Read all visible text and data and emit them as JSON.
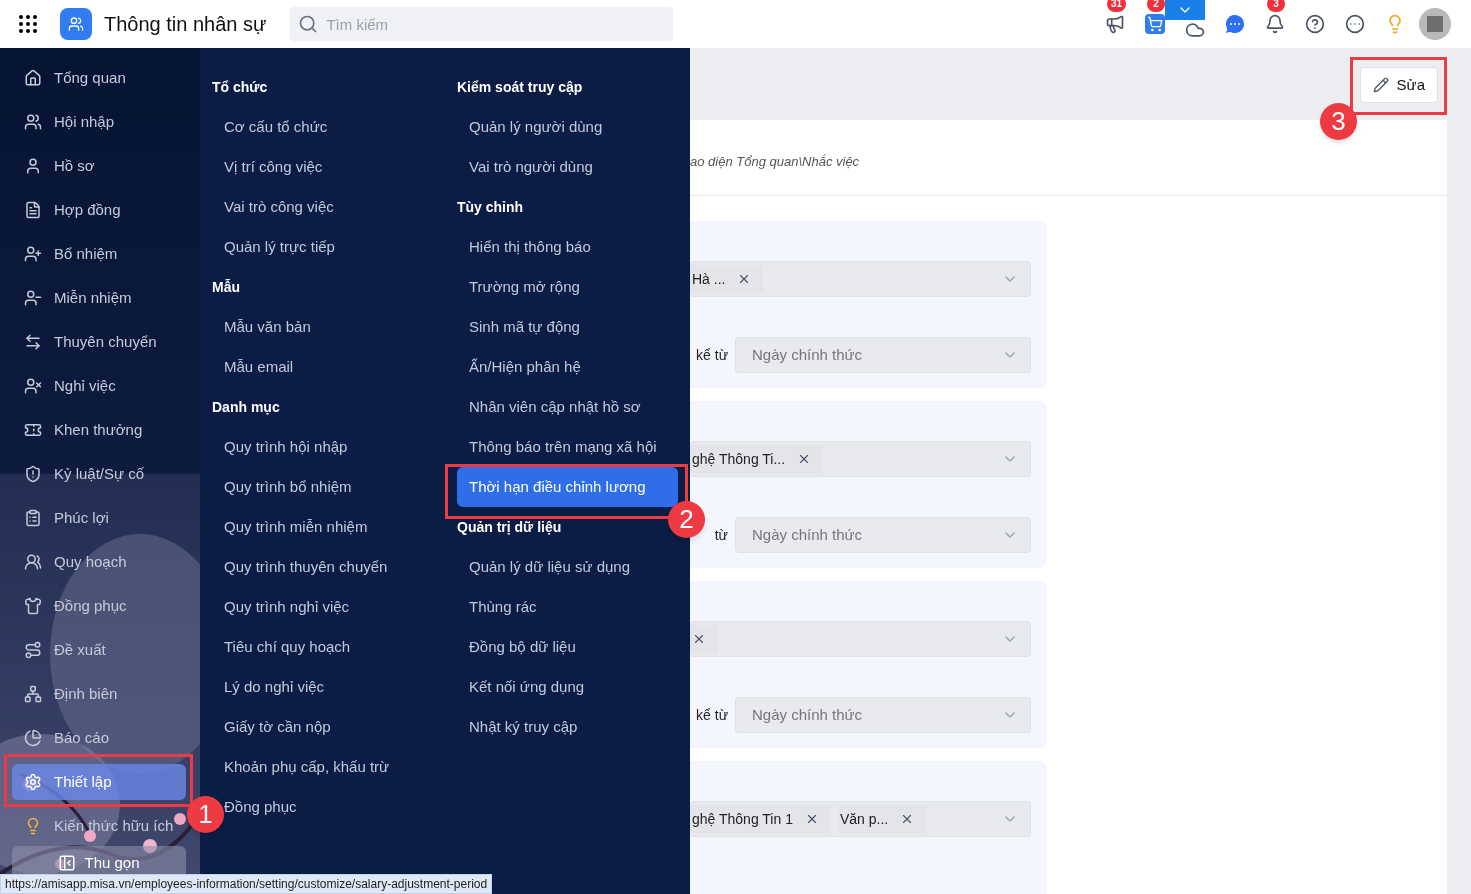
{
  "app": {
    "title": "Thông tin nhân sự"
  },
  "search": {
    "placeholder": "Tìm kiếm"
  },
  "header_icons": [
    {
      "kind": "megaphone",
      "badge": "31"
    },
    {
      "kind": "cart",
      "badge": "2"
    },
    {
      "kind": "cloud"
    },
    {
      "kind": "chat"
    },
    {
      "kind": "bell",
      "badge": "3"
    },
    {
      "kind": "help"
    },
    {
      "kind": "more"
    },
    {
      "kind": "idea"
    },
    {
      "kind": "avatar"
    }
  ],
  "sidebar": {
    "items": [
      {
        "label": "Tổng quan",
        "selected": false
      },
      {
        "label": "Hội nhập",
        "selected": false
      },
      {
        "label": "Hồ sơ",
        "selected": false
      },
      {
        "label": "Hợp đồng",
        "selected": false
      },
      {
        "label": "Bổ nhiệm",
        "selected": false
      },
      {
        "label": "Miễn nhiệm",
        "selected": false
      },
      {
        "label": "Thuyên chuyển",
        "selected": false
      },
      {
        "label": "Nghỉ việc",
        "selected": false
      },
      {
        "label": "Khen thưởng",
        "selected": false
      },
      {
        "label": "Kỷ luật/Sự cố",
        "selected": false
      },
      {
        "label": "Phúc lợi",
        "selected": false
      },
      {
        "label": "Quy hoạch",
        "selected": false
      },
      {
        "label": "Đồng phục",
        "selected": false
      },
      {
        "label": "Đề xuất",
        "selected": false
      },
      {
        "label": "Định biên",
        "selected": false
      },
      {
        "label": "Báo cáo",
        "selected": false
      },
      {
        "label": "Thiết lập",
        "selected": true
      },
      {
        "label": "Kiến thức hữu ích",
        "selected": false
      }
    ],
    "collapse_button": "Thu gọn"
  },
  "mega_menu": {
    "columns": [
      [
        {
          "heading": "Tổ chức",
          "items": [
            {
              "label": "Cơ cấu tổ chức",
              "selected": false
            },
            {
              "label": "Vị trí công việc",
              "selected": false
            },
            {
              "label": "Vai trò công việc",
              "selected": false
            },
            {
              "label": "Quản lý trực tiếp",
              "selected": false
            }
          ]
        },
        {
          "heading": "Mẫu",
          "items": [
            {
              "label": "Mẫu văn bản",
              "selected": false
            },
            {
              "label": "Mẫu email",
              "selected": false
            }
          ]
        },
        {
          "heading": "Danh mục",
          "items": [
            {
              "label": "Quy trình hội nhập",
              "selected": false
            },
            {
              "label": "Quy trình bổ nhiệm",
              "selected": false
            },
            {
              "label": "Quy trình miễn nhiệm",
              "selected": false
            },
            {
              "label": "Quy trình thuyên chuyển",
              "selected": false
            },
            {
              "label": "Quy trình nghỉ việc",
              "selected": false
            },
            {
              "label": "Tiêu chí quy hoạch",
              "selected": false
            },
            {
              "label": "Lý do nghỉ việc",
              "selected": false
            },
            {
              "label": "Giấy tờ cần nộp",
              "selected": false
            },
            {
              "label": "Khoản phụ cấp, khấu trừ",
              "selected": false
            },
            {
              "label": "Đồng phục",
              "selected": false
            }
          ]
        }
      ],
      [
        {
          "heading": "Kiểm soát truy cập",
          "items": [
            {
              "label": "Quản lý người dùng",
              "selected": false
            },
            {
              "label": "Vai trò người dùng",
              "selected": false
            }
          ]
        },
        {
          "heading": "Tùy chỉnh",
          "items": [
            {
              "label": "Hiển thị thông báo",
              "selected": false
            },
            {
              "label": "Trường mở rộng",
              "selected": false
            },
            {
              "label": "Sinh mã tự động",
              "selected": false
            },
            {
              "label": "Ẩn/Hiện phân hệ",
              "selected": false
            },
            {
              "label": "Nhân viên cập nhật hồ sơ",
              "selected": false
            },
            {
              "label": "Thông báo trên mạng xã hội",
              "selected": false
            },
            {
              "label": "Thời hạn điều chỉnh lương",
              "selected": true
            }
          ]
        },
        {
          "heading": "Quản trị dữ liệu",
          "items": [
            {
              "label": "Quản lý dữ liệu sử dụng",
              "selected": false
            },
            {
              "label": "Thùng rác",
              "selected": false
            },
            {
              "label": "Đồng bộ dữ liệu",
              "selected": false
            },
            {
              "label": "Kết nối ứng dụng",
              "selected": false
            },
            {
              "label": "Nhật ký truy cập",
              "selected": false
            }
          ]
        }
      ]
    ]
  },
  "page": {
    "edit_button": "Sửa",
    "description": "ao diện Tổng quan\\Nhắc việc",
    "cards": [
      {
        "tags": [
          {
            "label": "Hà ..."
          }
        ],
        "since_label": "kể từ",
        "since_value": "Ngày chính thức"
      },
      {
        "tags": [
          {
            "label": "ghệ Thông Ti..."
          }
        ],
        "since_label": "từ",
        "since_value": "Ngày chính thức"
      },
      {
        "tags": [
          {
            "kind": "unlabeled"
          }
        ],
        "since_label": "kể từ",
        "since_value": "Ngày chính thức"
      },
      {
        "tags": [
          {
            "label": "ghệ Thông Tin 1"
          },
          {
            "label": "Văn p..."
          }
        ]
      }
    ]
  },
  "annotations": [
    {
      "label": "1"
    },
    {
      "label": "2"
    },
    {
      "label": "3"
    }
  ],
  "status_url": "https://amisapp.misa.vn/employees-information/setting/customize/salary-adjustment-period"
}
